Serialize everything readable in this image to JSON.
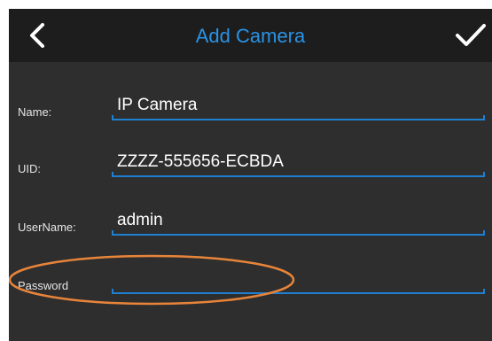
{
  "header": {
    "title": "Add Camera",
    "back_icon": "chevron-left-icon",
    "confirm_icon": "checkmark-icon",
    "title_color": "#2a93e6"
  },
  "form": {
    "name_label": "Name:",
    "name_value": "IP Camera",
    "uid_label": "UID:",
    "uid_value": "ZZZZ-555656-ECBDA",
    "username_label": "UserName:",
    "username_value": "admin",
    "password_label": "Password",
    "password_value": "",
    "underline_color": "#1f7fd0"
  },
  "annotation": {
    "highlight_color": "#e8843a"
  }
}
